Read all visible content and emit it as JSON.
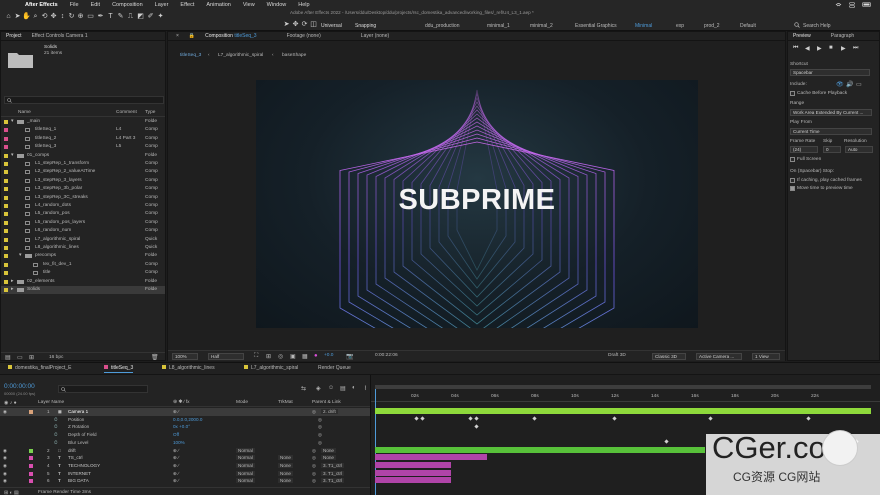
{
  "menubar": {
    "app": "After Effects",
    "items": [
      "File",
      "Edit",
      "Composition",
      "Layer",
      "Effect",
      "Animation",
      "View",
      "Window",
      "Help"
    ]
  },
  "window_title": "Adobe After Effects 2022 - /Users/ddu/Desktop/ddu/projects/rsc_domestika_advanced/working_files/_ref/U4_L3_1.aep *",
  "toolbar": {
    "universal": "Universal",
    "snapping": "Snapping",
    "workspaces": [
      "ddu_production",
      "minimal_1",
      "minimal_2",
      "Essential Graphics",
      "Minimal",
      "exp",
      "prod_2",
      "Default"
    ],
    "active_workspace": "Minimal",
    "search_help": "Search Help"
  },
  "project": {
    "tab": "Project",
    "effect_controls": "Effect Controls Camera 1",
    "selected_name": "Solids",
    "selected_info": "21 items",
    "search_placeholder": "",
    "col_name": "Name",
    "col_comment": "Comment",
    "col_type": "Type",
    "items": [
      {
        "name": "_main",
        "comment": "",
        "type": "Folde",
        "indent": 0,
        "kind": "folder",
        "color": "#d9c53a",
        "open": true
      },
      {
        "name": "titleSeq_1",
        "comment": "L4",
        "type": "Comp",
        "indent": 1,
        "kind": "comp",
        "color": "#d94f8c"
      },
      {
        "name": "titleSeq_2",
        "comment": "L4 Part 3",
        "type": "Comp",
        "indent": 1,
        "kind": "comp",
        "color": "#d94f8c"
      },
      {
        "name": "titleSeq_3",
        "comment": "L5",
        "type": "Comp",
        "indent": 1,
        "kind": "comp",
        "color": "#d94f8c"
      },
      {
        "name": "01_comps",
        "comment": "",
        "type": "Folde",
        "indent": 0,
        "kind": "folder",
        "color": "#d9c53a",
        "open": true
      },
      {
        "name": "L1_stepRep_1_transform",
        "comment": "",
        "type": "Comp",
        "indent": 1,
        "kind": "comp",
        "color": "#d9c53a"
      },
      {
        "name": "L2_stepRep_2_valueAtTime",
        "comment": "",
        "type": "Comp",
        "indent": 1,
        "kind": "comp",
        "color": "#d9c53a"
      },
      {
        "name": "L3_stepRep_3_layers",
        "comment": "",
        "type": "Comp",
        "indent": 1,
        "kind": "comp",
        "color": "#d9c53a"
      },
      {
        "name": "L3_stepRep_3b_polar",
        "comment": "",
        "type": "Comp",
        "indent": 1,
        "kind": "comp",
        "color": "#d9c53a"
      },
      {
        "name": "L3_stepRep_3C_streaks",
        "comment": "",
        "type": "Comp",
        "indent": 1,
        "kind": "comp",
        "color": "#d9c53a"
      },
      {
        "name": "L4_random_dots",
        "comment": "",
        "type": "Comp",
        "indent": 1,
        "kind": "comp",
        "color": "#d9c53a"
      },
      {
        "name": "L5_random_pos",
        "comment": "",
        "type": "Comp",
        "indent": 1,
        "kind": "comp",
        "color": "#d9c53a"
      },
      {
        "name": "L5_random_pos_layers",
        "comment": "",
        "type": "Comp",
        "indent": 1,
        "kind": "comp",
        "color": "#d9c53a"
      },
      {
        "name": "L6_random_num",
        "comment": "",
        "type": "Comp",
        "indent": 1,
        "kind": "comp",
        "color": "#d9c53a"
      },
      {
        "name": "L7_algorithmic_spiral",
        "comment": "",
        "type": "Quick",
        "indent": 1,
        "kind": "comp",
        "color": "#d9c53a"
      },
      {
        "name": "L8_algorithmic_lines",
        "comment": "",
        "type": "Quick",
        "indent": 1,
        "kind": "comp",
        "color": "#d9c53a"
      },
      {
        "name": "precomps",
        "comment": "",
        "type": "Folde",
        "indent": 1,
        "kind": "folder",
        "color": "#d9c53a",
        "open": true
      },
      {
        "name": "tex_fit_dev_1",
        "comment": "",
        "type": "Comp",
        "indent": 2,
        "kind": "comp",
        "color": "#d9c53a"
      },
      {
        "name": "title",
        "comment": "",
        "type": "Comp",
        "indent": 2,
        "kind": "comp",
        "color": "#d9c53a"
      },
      {
        "name": "02_elements",
        "comment": "",
        "type": "Folde",
        "indent": 0,
        "kind": "folder",
        "color": "#d9c53a",
        "open": false
      },
      {
        "name": "Solids",
        "comment": "",
        "type": "Folde",
        "indent": 0,
        "kind": "folder",
        "color": "#d9c53a",
        "open": false,
        "selected": true
      }
    ],
    "bpc": "16 bpc"
  },
  "comp_panel": {
    "tab_prefix": "Composition",
    "comp_name": "titleSeq_3",
    "other_tabs": [
      "Footage (none)",
      "Layer (none)"
    ],
    "breadcrumbs": [
      "titleSeq_3",
      "L7_algorithmic_spiral",
      "baseShape"
    ],
    "title_text": "SUBPRIME",
    "footer": {
      "zoom": "100%",
      "resolution": "Half",
      "exposure": "+0.0",
      "timecode": "0:00:22:06",
      "renderer": "Draft 3D",
      "camera_mode": "Classic 3D",
      "view": "Active Camera ...",
      "views": "1 View"
    }
  },
  "preview": {
    "tab": "Preview",
    "tab2": "Paragraph",
    "shortcut_label": "Shortcut",
    "shortcut": "Spacebar",
    "include_label": "Include:",
    "cache_label": "Cache Before Playback",
    "range_label": "Range",
    "range": "Work Area Extended By Current ...",
    "play_from_label": "Play From",
    "play_from": "Current Time",
    "frame_rate_label": "Frame Rate",
    "skip_label": "Skip",
    "resolution_label": "Resolution",
    "frame_rate": "(24)",
    "skip": "0",
    "resolution": "Auto",
    "full_screen_label": "Full Screen",
    "on_stop_label": "On (Spacebar) Stop:",
    "if_caching_label": "If caching, play cached frames",
    "move_time_label": "Move time to preview time"
  },
  "timeline": {
    "tabs": [
      "domestika_finalProject_E",
      "titleSeq_3",
      "L8_algorithmic_lines",
      "L7_algorithmic_spiral",
      "Render Queue"
    ],
    "active_tab": "titleSeq_3",
    "timecode": "0:00:00:00",
    "timecode_sub": "00000 (24.00 fps)",
    "search_placeholder": "",
    "col_layer_name": "Layer Name",
    "col_mode": "Mode",
    "col_trkmat": "TrkMat",
    "col_parent": "Parent & Link",
    "ruler": [
      "02s",
      "04s",
      "06s",
      "08s",
      "10s",
      "12s",
      "14s",
      "16s",
      "18s",
      "20s",
      "22s"
    ],
    "layers": [
      {
        "num": "1",
        "name": "Camera 1",
        "type": "camera",
        "color": "#d9a27a",
        "mode": "",
        "trkmat": "",
        "parent": "2. drift",
        "selected": true
      },
      {
        "num": "",
        "name": "Position",
        "value": "0.0,0.0,2000.0",
        "prop": true
      },
      {
        "num": "",
        "name": "Z Rotation",
        "value": "0x +0.0°",
        "prop": true
      },
      {
        "num": "",
        "name": "Depth of Field",
        "value": "Off",
        "prop": true
      },
      {
        "num": "",
        "name": "Blur Level",
        "value": "100%",
        "prop": true
      },
      {
        "num": "2",
        "name": "drift",
        "type": "null",
        "color": "#7ad14f",
        "mode": "Normal",
        "trkmat": "",
        "parent": "None"
      },
      {
        "num": "3",
        "name": "TS_ctrl",
        "type": "text",
        "color": "#d94fb0",
        "mode": "Normal",
        "trkmat": "None",
        "parent": "None"
      },
      {
        "num": "4",
        "name": "TECHNOLOGY",
        "type": "text",
        "color": "#d94fb0",
        "mode": "Normal",
        "trkmat": "None",
        "parent": "3. T1_ctrl"
      },
      {
        "num": "5",
        "name": "INTERNET",
        "type": "text",
        "color": "#d94fb0",
        "mode": "Normal",
        "trkmat": "None",
        "parent": "3. T1_ctrl"
      },
      {
        "num": "6",
        "name": "BIG DATA",
        "type": "text",
        "color": "#d94fb0",
        "mode": "Normal",
        "trkmat": "None",
        "parent": "3. T1_ctrl"
      }
    ],
    "footer": "Frame Render Time  3ms"
  },
  "watermark": {
    "main": "CGer.com",
    "sub": "CG资源 CG网站"
  }
}
